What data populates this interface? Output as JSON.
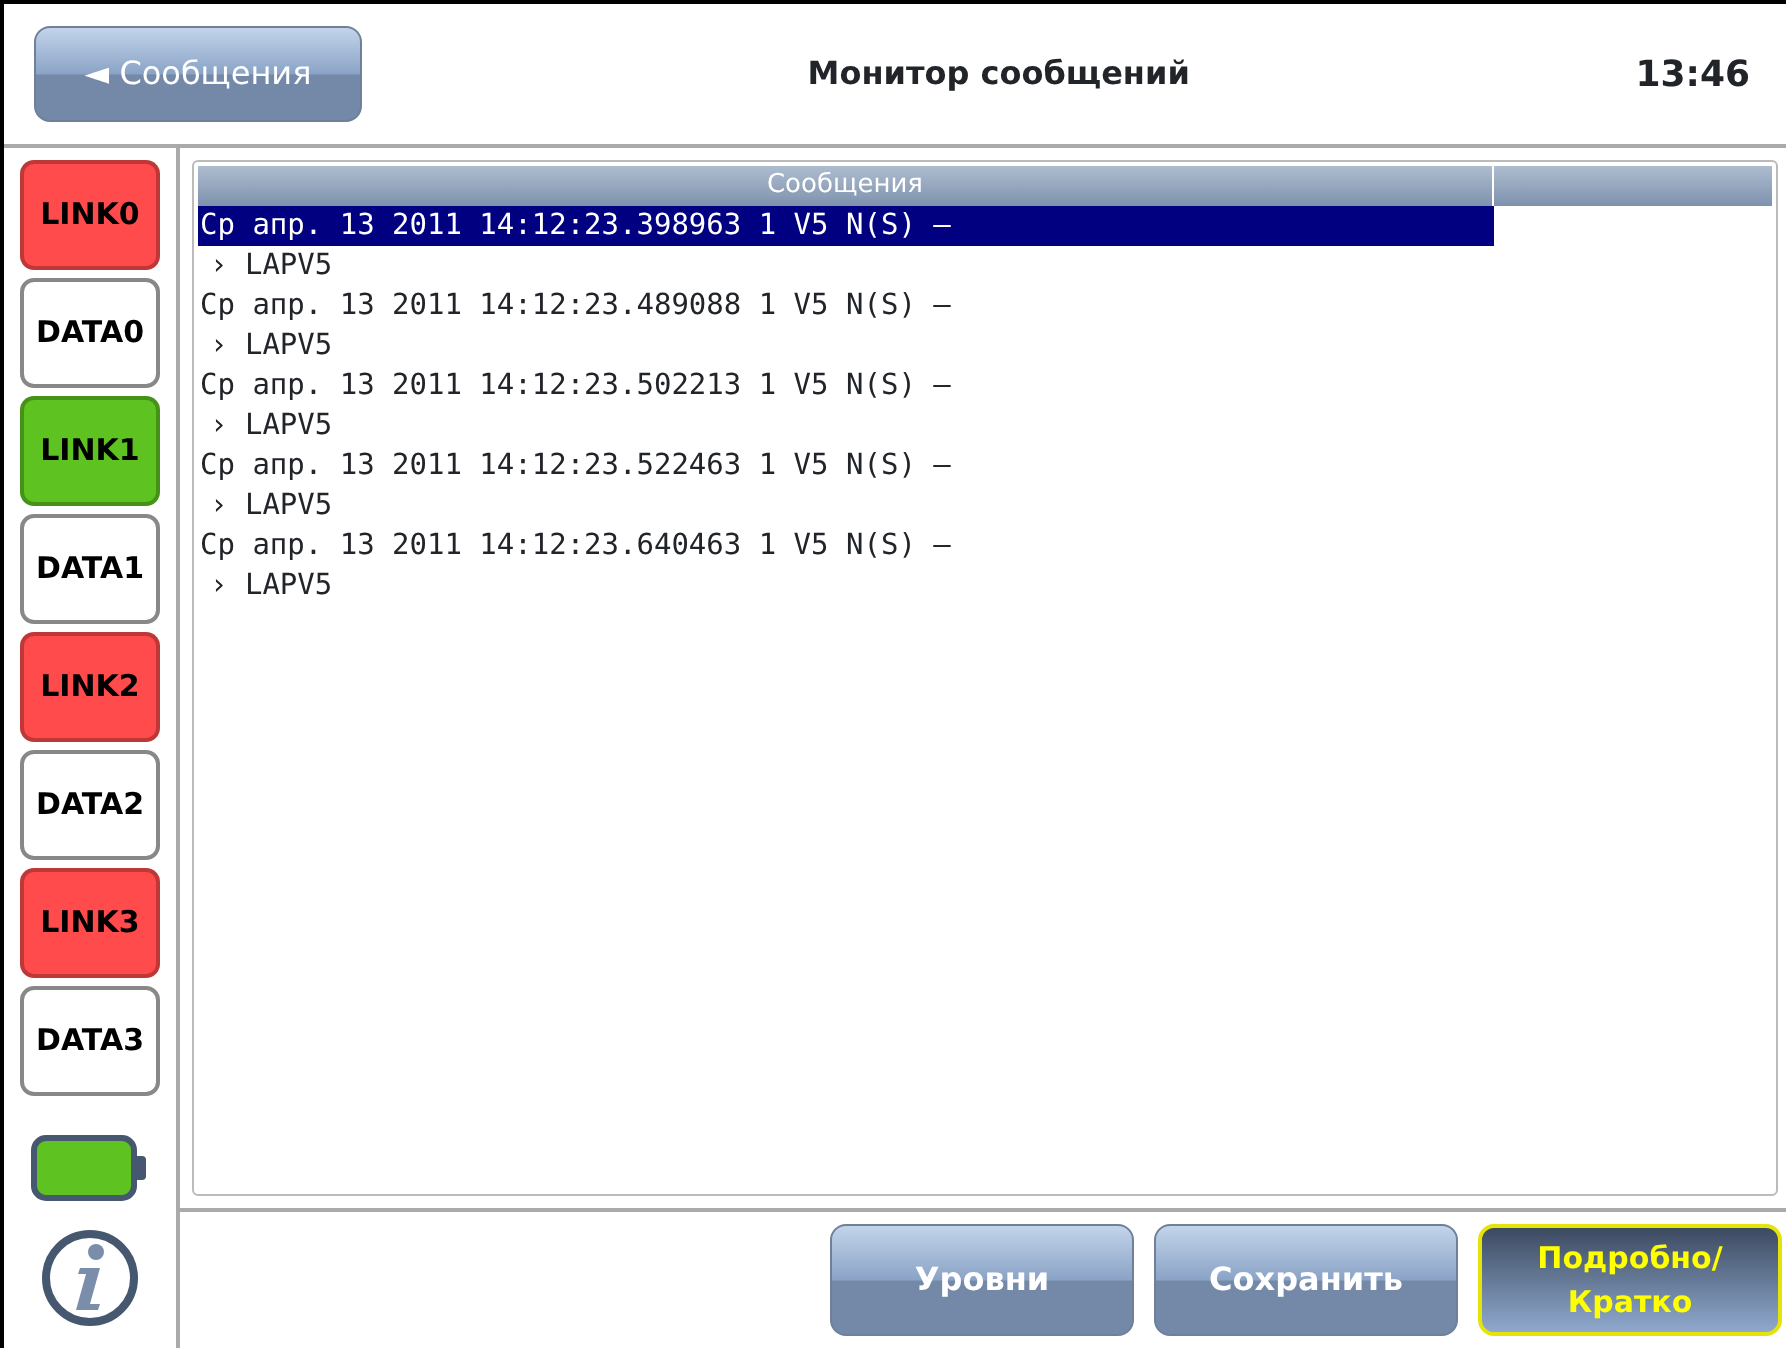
{
  "header": {
    "back_button": "◄ Сообщения",
    "title": "Монитор сообщений",
    "time": "13:46"
  },
  "sidebar": {
    "items": [
      {
        "label": "LINK0",
        "color": "#ff4b4b"
      },
      {
        "label": "DATA0",
        "color": "#ffffff"
      },
      {
        "label": "LINK1",
        "color": "#5ec321"
      },
      {
        "label": "DATA1",
        "color": "#ffffff"
      },
      {
        "label": "LINK2",
        "color": "#ff4b4b"
      },
      {
        "label": "DATA2",
        "color": "#ffffff"
      },
      {
        "label": "LINK3",
        "color": "#ff4b4b"
      },
      {
        "label": "DATA3",
        "color": "#ffffff"
      }
    ]
  },
  "table": {
    "columns": [
      "Сообщения"
    ],
    "rows": [
      {
        "text": "Ср апр. 13 2011 14:12:23.398963 1 V5 N(S) –",
        "detail": "› LAPV5",
        "selected": true
      },
      {
        "text": "Ср апр. 13 2011 14:12:23.489088 1 V5 N(S) –",
        "detail": "› LAPV5",
        "selected": false
      },
      {
        "text": "Ср апр. 13 2011 14:12:23.502213 1 V5 N(S) –",
        "detail": "› LAPV5",
        "selected": false
      },
      {
        "text": "Ср апр. 13 2011 14:12:23.522463 1 V5 N(S) –",
        "detail": "› LAPV5",
        "selected": false
      },
      {
        "text": "Ср апр. 13 2011 14:12:23.640463 1 V5 N(S) –",
        "detail": "› LAPV5",
        "selected": false
      }
    ]
  },
  "buttons": [
    {
      "label": "Уровни",
      "selected": false
    },
    {
      "label": "Сохранить",
      "selected": false
    },
    {
      "label": "Подробно/Кратко",
      "selected": true
    }
  ]
}
